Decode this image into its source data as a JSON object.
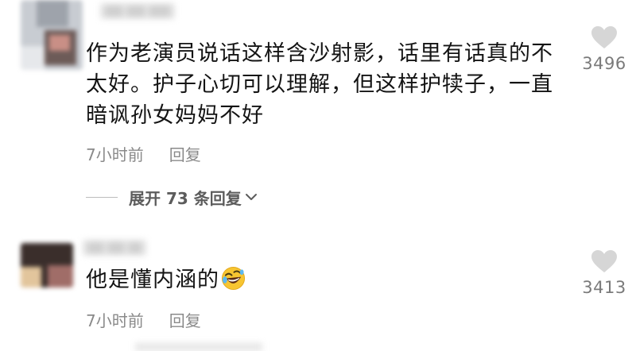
{
  "comments": [
    {
      "text": "作为老演员说话这样含沙射影，话里有话真的不太好。护子心切可以理解，但这样护犊子，一直暗讽孙女妈妈不好",
      "time": "7小时前",
      "reply_label": "回复",
      "likes": "3496",
      "like_icon": "heart-icon",
      "expand_label": "展开 73 条回复"
    },
    {
      "text": "他是懂内涵的",
      "emoji": "rolling-on-floor-laughing-emoji",
      "time": "7小时前",
      "reply_label": "回复",
      "likes": "3413",
      "like_icon": "heart-icon"
    }
  ],
  "colors": {
    "text": "#141414",
    "meta": "#8a8a8a",
    "like": "#d6d6d6",
    "expand": "#5c5c5c"
  }
}
